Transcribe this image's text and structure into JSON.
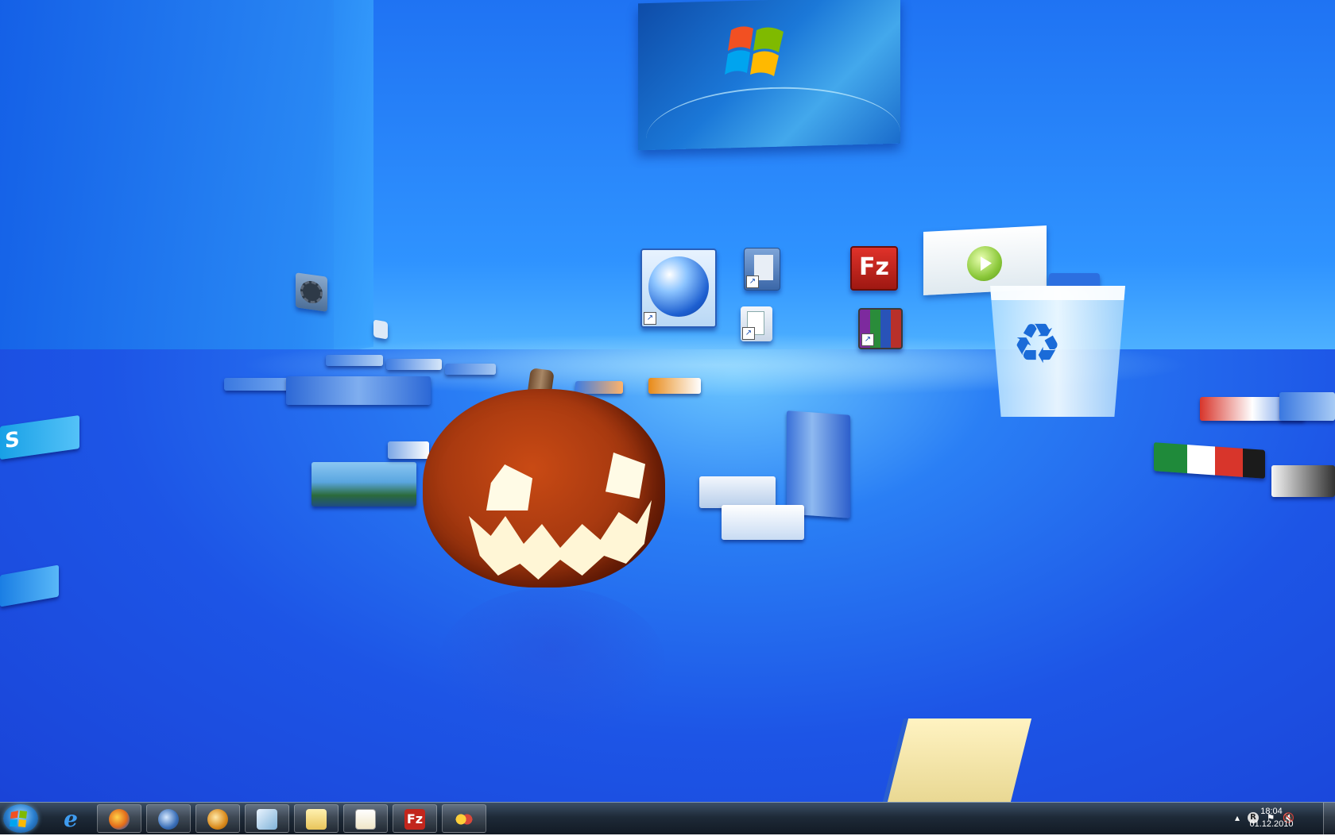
{
  "desktop": {
    "icons": [
      {
        "name": "google-earth-icon"
      },
      {
        "name": "document-icon"
      },
      {
        "name": "filezilla-icon",
        "label": "Fz"
      },
      {
        "name": "notepad-icon"
      },
      {
        "name": "winrar-icon"
      },
      {
        "name": "media-player-icon"
      },
      {
        "name": "recycle-bin-icon"
      },
      {
        "name": "folder-icon"
      }
    ],
    "wall_picture_logo": "windows-logo-icon"
  },
  "taskbar": {
    "start_icon": "windows-orb-icon",
    "buttons": [
      {
        "name": "internet-explorer-icon",
        "color": "#2f8de8"
      },
      {
        "name": "firefox-icon",
        "color": "#e26a1a"
      },
      {
        "name": "thunderbird-icon",
        "color": "#3a6fb8"
      },
      {
        "name": "paint-icon",
        "color": "#d98a1c"
      },
      {
        "name": "notes-icon",
        "color": "#7fb2d8"
      },
      {
        "name": "explorer-folder-icon",
        "color": "#e8c45a"
      },
      {
        "name": "notepad-icon",
        "color": "#f0e6c8"
      },
      {
        "name": "filezilla-icon",
        "color": "#c2261d",
        "label": "Fz"
      },
      {
        "name": "link-icon",
        "color": "#d8483a"
      }
    ],
    "tray": {
      "icons": [
        "chevron-up-icon",
        "app-r-icon",
        "flag-icon",
        "speaker-muted-icon"
      ],
      "r_label": "R",
      "time": "18:04",
      "date": "01.12.2010"
    }
  }
}
